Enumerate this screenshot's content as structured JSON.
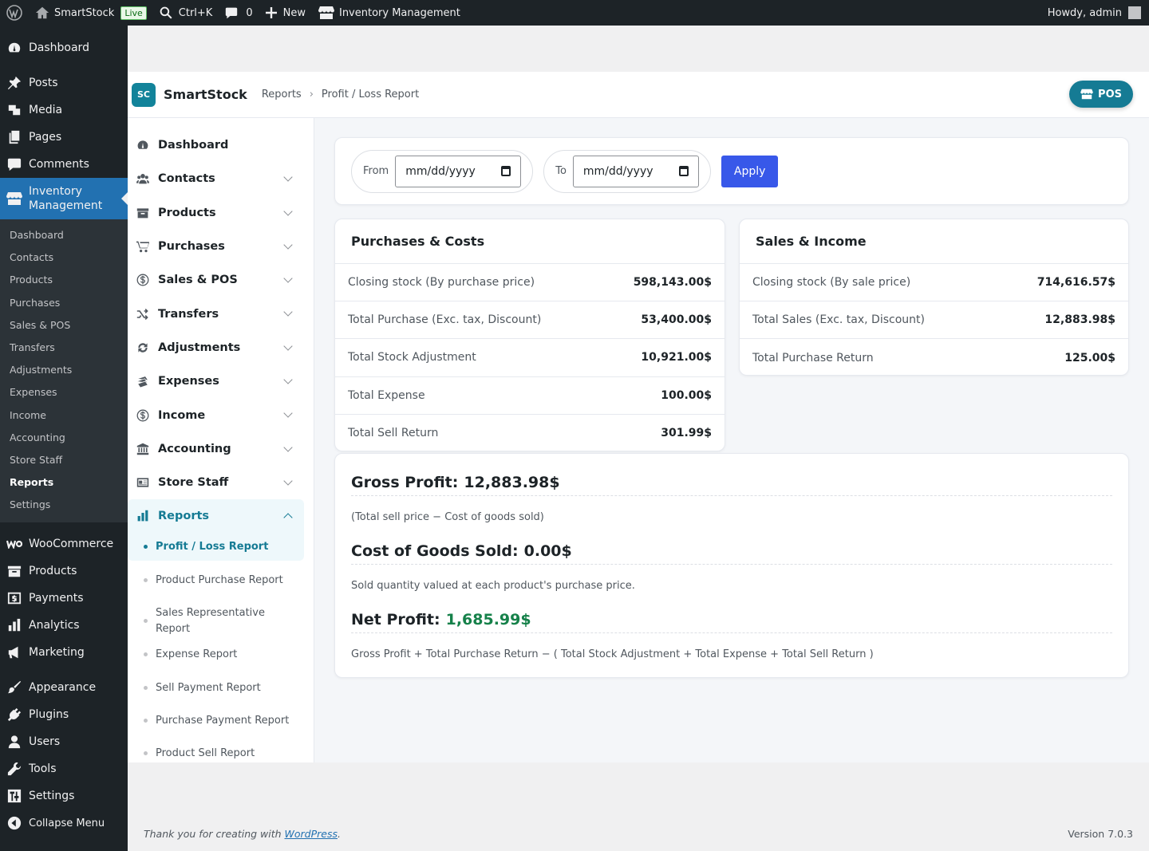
{
  "adminbar": {
    "site_name": "SmartStock",
    "live_badge": "Live",
    "search_shortcut": "Ctrl+K",
    "comments_count": "0",
    "new_label": "New",
    "plugin_link": "Inventory Management",
    "howdy": "Howdy, admin"
  },
  "wp_menu": {
    "dashboard": "Dashboard",
    "posts": "Posts",
    "media": "Media",
    "pages": "Pages",
    "comments": "Comments",
    "inventory": "Inventory Management",
    "inventory_sub": [
      "Dashboard",
      "Contacts",
      "Products",
      "Purchases",
      "Sales & POS",
      "Transfers",
      "Adjustments",
      "Expenses",
      "Income",
      "Accounting",
      "Store Staff",
      "Reports",
      "Settings"
    ],
    "woocommerce": "WooCommerce",
    "products": "Products",
    "payments": "Payments",
    "analytics": "Analytics",
    "marketing": "Marketing",
    "appearance": "Appearance",
    "plugins": "Plugins",
    "users": "Users",
    "tools": "Tools",
    "settings": "Settings",
    "collapse": "Collapse Menu"
  },
  "plugin_header": {
    "logo_text": "SC",
    "brand": "SmartStock",
    "breadcrumb": [
      "Reports",
      "›",
      "Profit / Loss Report"
    ],
    "pos_label": "POS"
  },
  "plugin_nav": {
    "items": [
      "Dashboard",
      "Contacts",
      "Products",
      "Purchases",
      "Sales & POS",
      "Transfers",
      "Adjustments",
      "Expenses",
      "Income",
      "Accounting",
      "Store Staff",
      "Reports"
    ],
    "reports_sub": [
      "Profit / Loss Report",
      "Product Purchase Report",
      "Sales Representative Report",
      "Expense Report",
      "Sell Payment Report",
      "Purchase Payment Report",
      "Product Sell Report"
    ]
  },
  "filters": {
    "from_label": "From",
    "to_label": "To",
    "date_placeholder": "mm/dd/yyyy",
    "apply_label": "Apply"
  },
  "purchases": {
    "title": "Purchases & Costs",
    "rows": [
      {
        "label": "Closing stock (By purchase price)",
        "value": "598,143.00$"
      },
      {
        "label": "Total Purchase (Exc. tax, Discount)",
        "value": "53,400.00$"
      },
      {
        "label": "Total Stock Adjustment",
        "value": "10,921.00$"
      },
      {
        "label": "Total Expense",
        "value": "100.00$"
      },
      {
        "label": "Total Sell Return",
        "value": "301.99$"
      }
    ]
  },
  "sales": {
    "title": "Sales & Income",
    "rows": [
      {
        "label": "Closing stock (By sale price)",
        "value": "714,616.57$"
      },
      {
        "label": "Total Sales (Exc. tax, Discount)",
        "value": "12,883.98$"
      },
      {
        "label": "Total Purchase Return",
        "value": "125.00$"
      }
    ]
  },
  "profit": {
    "gross_label": "Gross Profit:",
    "gross_value": "12,883.98$",
    "gross_desc": "(Total sell price − Cost of goods sold)",
    "cogs_label": "Cost of Goods Sold:",
    "cogs_value": "0.00$",
    "cogs_desc": "Sold quantity valued at each product's purchase price.",
    "net_label": "Net Profit:",
    "net_value": "1,685.99$",
    "net_desc": "Gross Profit + Total Purchase Return − ( Total Stock Adjustment + Total Expense + Total Sell Return )"
  },
  "footer": {
    "thanks_prefix": "Thank you for creating with ",
    "wp_link": "WordPress",
    "thanks_suffix": ".",
    "version": "Version 7.0.3"
  },
  "colors": {
    "accent_teal": "#157b94",
    "apply_blue": "#3858e9",
    "net_profit_green": "#16814a",
    "wp_current_blue": "#2271b1"
  }
}
